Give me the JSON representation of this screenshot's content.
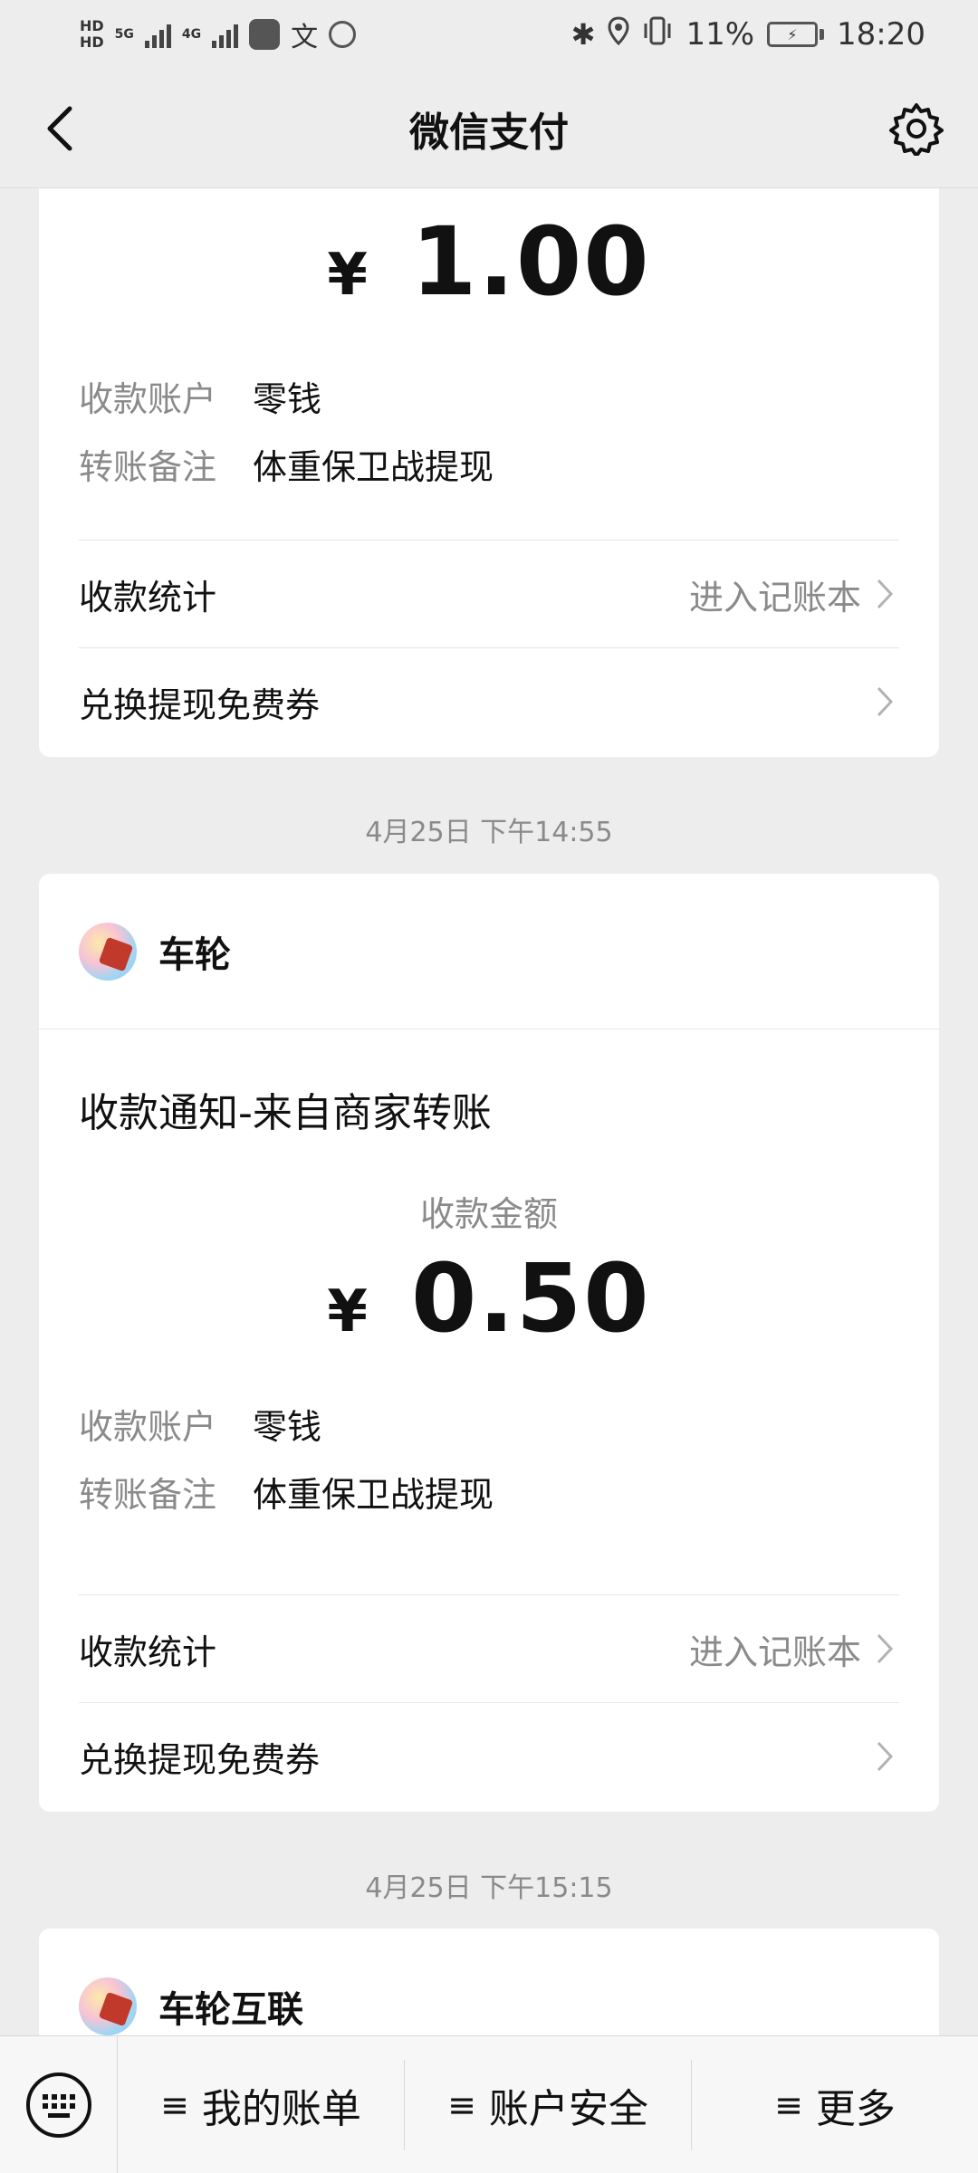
{
  "status_bar": {
    "hd_top": "HD",
    "hd_bottom": "HD",
    "net1": "5G",
    "net2": "4G",
    "battery": "11%",
    "time": "18:20"
  },
  "nav": {
    "title": "微信支付"
  },
  "cards": [
    {
      "amount_yen": "¥",
      "amount": "1.00",
      "info": [
        {
          "k": "收款账户",
          "v": "零钱"
        },
        {
          "k": "转账备注",
          "v": "体重保卫战提现"
        }
      ],
      "stats_label": "收款统计",
      "stats_link": "进入记账本",
      "coupon_label": "兑换提现免费券"
    },
    {
      "timestamp": "4月25日 下午14:55",
      "merchant": "车轮",
      "title": "收款通知-来自商家转账",
      "amount_label": "收款金额",
      "amount_yen": "¥",
      "amount": "0.50",
      "info": [
        {
          "k": "收款账户",
          "v": "零钱"
        },
        {
          "k": "转账备注",
          "v": "体重保卫战提现"
        }
      ],
      "stats_label": "收款统计",
      "stats_link": "进入记账本",
      "coupon_label": "兑换提现免费券"
    },
    {
      "timestamp": "4月25日 下午15:15",
      "merchant": "车轮互联"
    }
  ],
  "bottom_menu": {
    "items": [
      {
        "icon": "≡",
        "label": "我的账单"
      },
      {
        "icon": "≡",
        "label": "账户安全"
      },
      {
        "icon": "≡",
        "label": "更多"
      }
    ]
  }
}
